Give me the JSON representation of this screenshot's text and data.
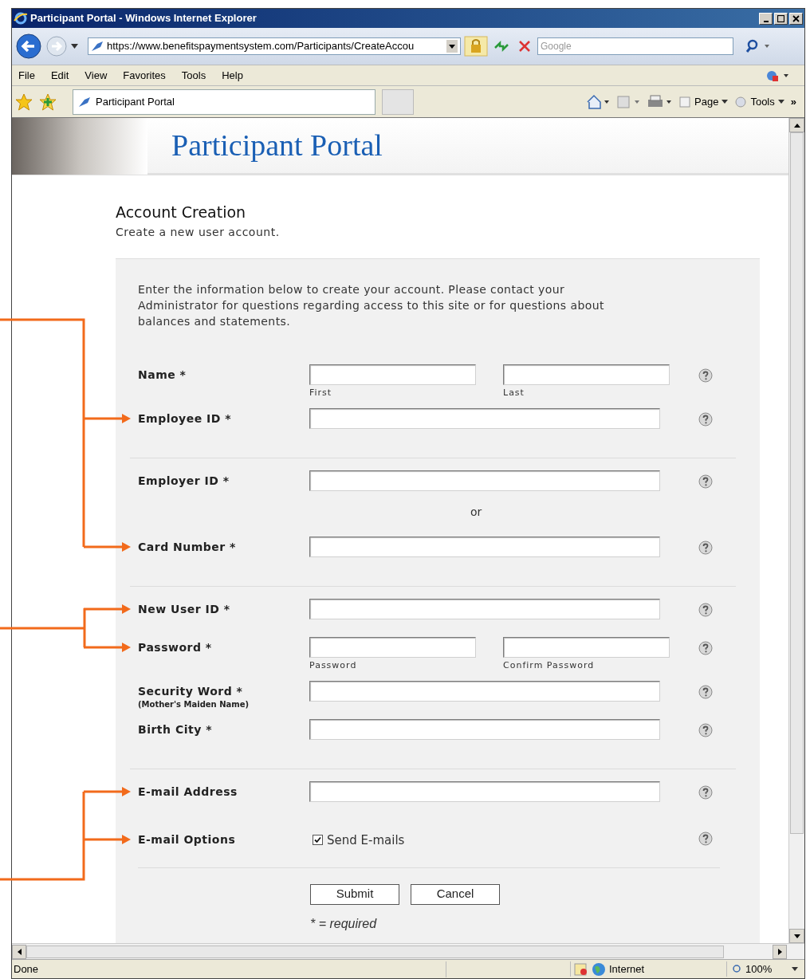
{
  "browser": {
    "title": "Participant Portal - Windows Internet Explorer",
    "address": "https://www.benefitspaymentsystem.com/Participants/CreateAccou",
    "search_placeholder": "Google",
    "menu": [
      "File",
      "Edit",
      "View",
      "Favorites",
      "Tools",
      "Help"
    ],
    "tab": "Participant Portal",
    "toolbar": [
      "Page",
      "Tools"
    ],
    "toolbar_overflow": "»",
    "status": "Done",
    "zone": "Internet",
    "zoom": "100%"
  },
  "page": {
    "banner_title": "Participant Portal",
    "heading": "Account Creation",
    "subheading": "Create a new user account.",
    "intro": "Enter the information below to create your account. Please contact your Administrator for questions regarding access to this site or for questions about balances and statements.",
    "rows": [
      {
        "kind": "pair",
        "label": "Name *",
        "sublabels": [
          "First",
          "Last"
        ]
      },
      {
        "kind": "single",
        "label": "Employee ID *"
      },
      {
        "kind": "divider"
      },
      {
        "kind": "single",
        "label": "Employer ID *"
      },
      {
        "kind": "or",
        "text": "or"
      },
      {
        "kind": "single",
        "label": "Card Number *"
      },
      {
        "kind": "divider"
      },
      {
        "kind": "single",
        "label": "New User ID *"
      },
      {
        "kind": "pair",
        "label": "Password *",
        "sublabels": [
          "Password",
          "Confirm Password"
        ]
      },
      {
        "kind": "single",
        "label": "Security Word *",
        "note": "(Mother's Maiden Name)"
      },
      {
        "kind": "single",
        "label": "Birth City *"
      },
      {
        "kind": "divider"
      },
      {
        "kind": "single",
        "label": "E-mail Address"
      },
      {
        "kind": "checkbox",
        "label": "E-mail Options",
        "option": "Send E-mails",
        "checked": true
      }
    ],
    "buttons": [
      "Submit",
      "Cancel"
    ],
    "required_note": "* = required"
  }
}
